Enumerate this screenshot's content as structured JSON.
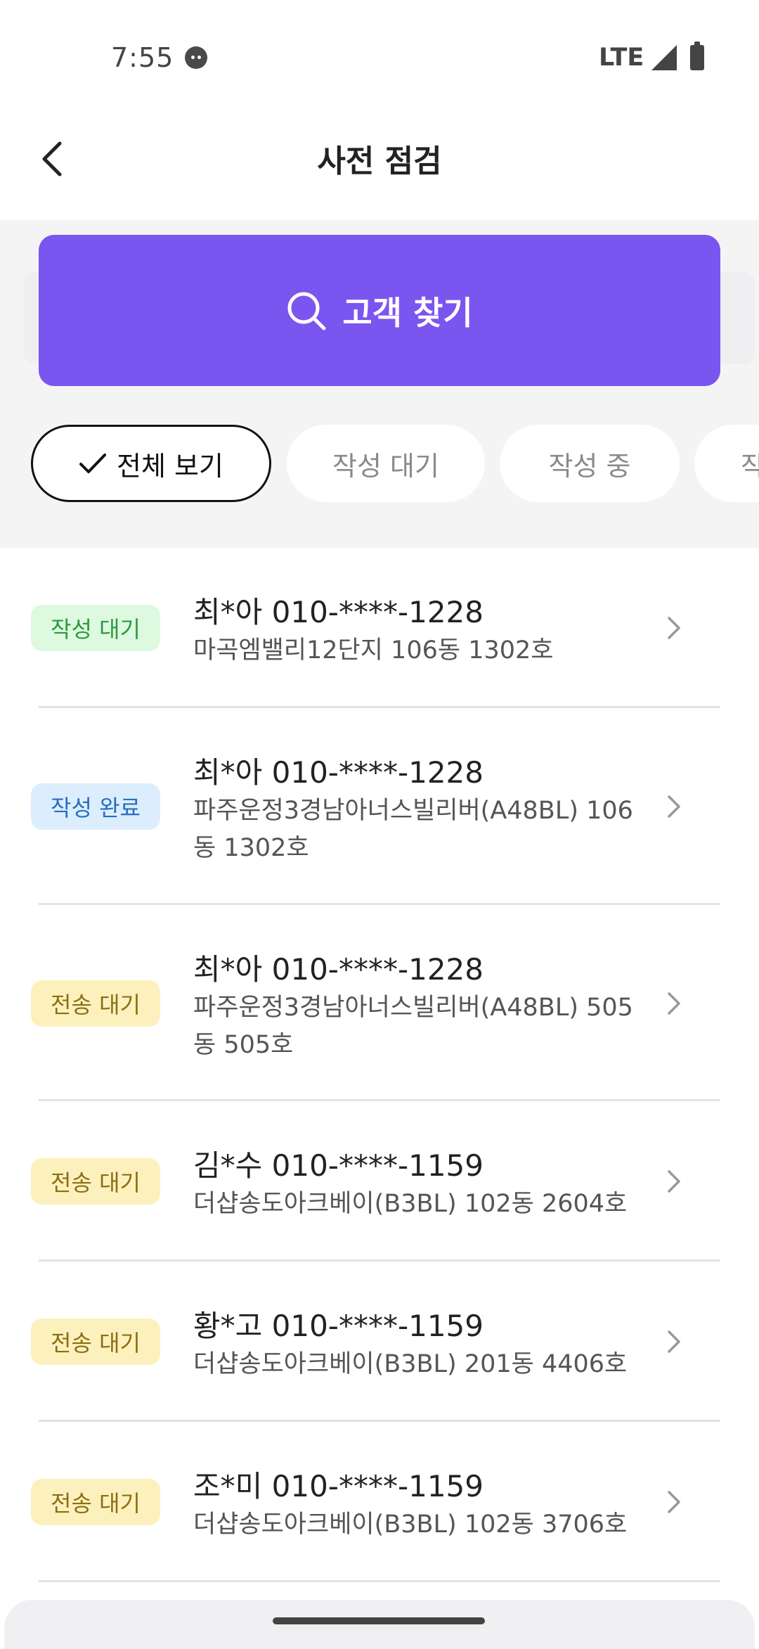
{
  "status_bar": {
    "time": "7:55",
    "network": "LTE",
    "icons": [
      "face-icon",
      "signal-icon",
      "battery-icon"
    ]
  },
  "app_bar": {
    "title": "사전 점검",
    "back_icon": "chevron-left-icon"
  },
  "search": {
    "label": "고객 찾기",
    "icon": "search-icon",
    "color": "#7b55f0"
  },
  "filters": [
    {
      "label": "전체 보기",
      "active": true
    },
    {
      "label": "작성 대기",
      "active": false
    },
    {
      "label": "작성 중",
      "active": false
    },
    {
      "label": "작",
      "active": false
    }
  ],
  "customers": [
    {
      "status": "작성 대기",
      "status_type": "waiting",
      "title": "최*아 010-****-1228",
      "address": "마곡엠밸리12단지 106동 1302호"
    },
    {
      "status": "작성 완료",
      "status_type": "done",
      "title": "최*아 010-****-1228",
      "address": "파주운정3경남아너스빌리버(A48BL) 106동 1302호"
    },
    {
      "status": "전송 대기",
      "status_type": "send",
      "title": "최*아 010-****-1228",
      "address": "파주운정3경남아너스빌리버(A48BL) 505동 505호"
    },
    {
      "status": "전송 대기",
      "status_type": "send",
      "title": "김*수 010-****-1159",
      "address": "더샵송도아크베이(B3BL) 102동 2604호"
    },
    {
      "status": "전송 대기",
      "status_type": "send",
      "title": "황*고 010-****-1159",
      "address": "더샵송도아크베이(B3BL) 201동 4406호"
    },
    {
      "status": "전송 대기",
      "status_type": "send",
      "title": "조*미 010-****-1159",
      "address": "더샵송도아크베이(B3BL) 102동 3706호"
    }
  ],
  "colors": {
    "waiting": "#2d9a3d",
    "done": "#2a6dc0",
    "send": "#8c6e13"
  }
}
